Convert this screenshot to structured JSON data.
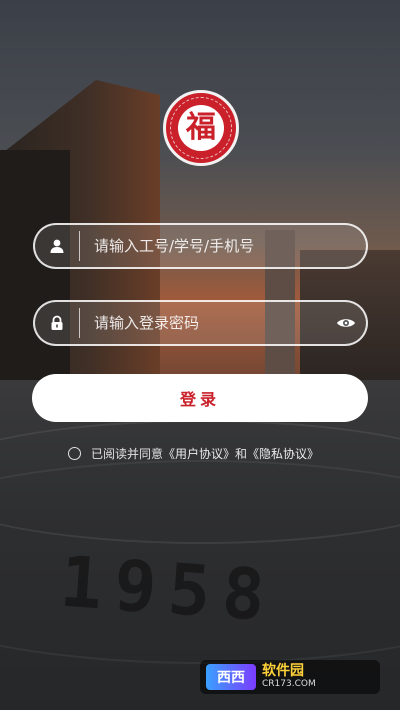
{
  "logo": {
    "character": "福"
  },
  "login": {
    "account_placeholder": "请输入工号/学号/手机号",
    "password_placeholder": "请输入登录密码",
    "submit_label": "登录"
  },
  "agreement": {
    "prefix": "已阅读并同意",
    "user_agreement": "《用户协议》",
    "conjunction": "和",
    "privacy_policy": "《隐私协议》"
  },
  "background": {
    "year": "1958"
  },
  "watermark": {
    "mark": "西西",
    "title": "软件园",
    "sub": "CR173.COM"
  },
  "icons": {
    "account": "user-icon",
    "password": "lock-icon",
    "visibility": "eye-icon",
    "agree": "radio-unchecked-icon"
  },
  "colors": {
    "accent": "#c9202a",
    "button_bg": "#ffffff"
  }
}
